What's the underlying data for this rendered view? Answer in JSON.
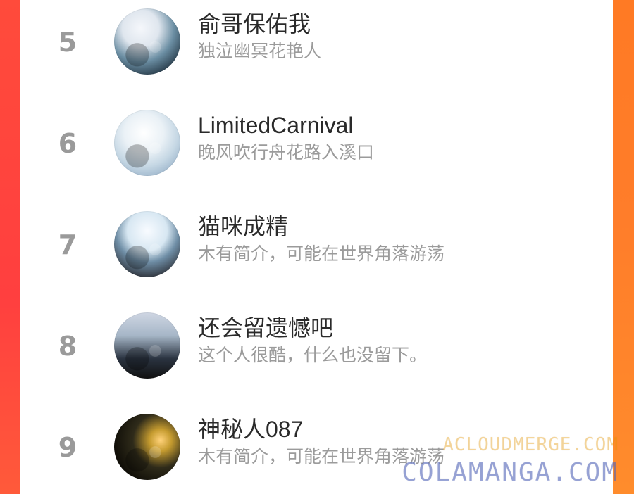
{
  "leaderboard": {
    "items": [
      {
        "rank": "5",
        "name": "俞哥保佑我",
        "bio": "独泣幽冥花艳人",
        "avatar_icon": "avatar-image"
      },
      {
        "rank": "6",
        "name": "LimitedCarnival",
        "bio": "晚风吹行舟花路入溪口",
        "avatar_icon": "avatar-image"
      },
      {
        "rank": "7",
        "name": "猫咪成精",
        "bio": "木有简介，可能在世界角落游荡",
        "avatar_icon": "avatar-image"
      },
      {
        "rank": "8",
        "name": "还会留遗憾吧",
        "bio": "这个人很酷，什么也没留下。",
        "avatar_icon": "avatar-image"
      },
      {
        "rank": "9",
        "name": "神秘人087",
        "bio": "木有简介，可能在世界角落游荡",
        "avatar_icon": "avatar-image"
      }
    ]
  },
  "watermark": {
    "line1": "ACLOUDMERGE.COM",
    "line2": "COLAMANGA.COM",
    "color1": "#ffa500",
    "color2": "#5a6ec8"
  },
  "theme": {
    "accent_left": "#ff4b3b",
    "accent_right": "#ff7b2e",
    "panel_bg": "#ffffff",
    "rank_color": "#9a9a9a",
    "name_color": "#2a2a2a",
    "bio_color": "#9b9b9b"
  }
}
